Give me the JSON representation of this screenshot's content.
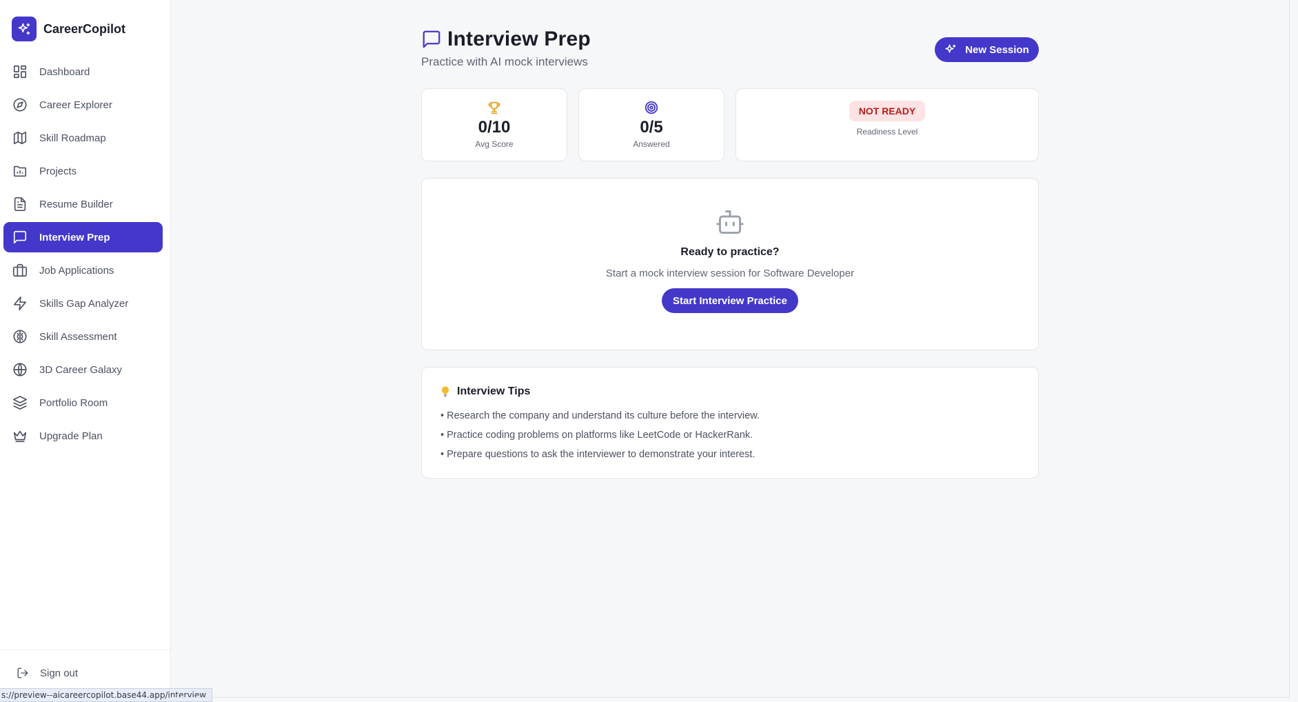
{
  "app": {
    "name": "CareerCopilot"
  },
  "sidebar": {
    "items": [
      {
        "label": "Dashboard",
        "icon": "grid-icon",
        "active": false
      },
      {
        "label": "Career Explorer",
        "icon": "compass-icon",
        "active": false
      },
      {
        "label": "Skill Roadmap",
        "icon": "map-icon",
        "active": false
      },
      {
        "label": "Projects",
        "icon": "folder-icon",
        "active": false
      },
      {
        "label": "Resume Builder",
        "icon": "file-text-icon",
        "active": false
      },
      {
        "label": "Interview Prep",
        "icon": "message-square-icon",
        "active": true
      },
      {
        "label": "Job Applications",
        "icon": "briefcase-icon",
        "active": false
      },
      {
        "label": "Skills Gap Analyzer",
        "icon": "zap-icon",
        "active": false
      },
      {
        "label": "Skill Assessment",
        "icon": "brain-icon",
        "active": false
      },
      {
        "label": "3D Career Galaxy",
        "icon": "globe-icon",
        "active": false
      },
      {
        "label": "Portfolio Room",
        "icon": "layers-icon",
        "active": false
      },
      {
        "label": "Upgrade Plan",
        "icon": "crown-icon",
        "active": false
      }
    ],
    "sign_out": "Sign out"
  },
  "status_url": "s://preview--aicareercopilot.base44.app/interview",
  "header": {
    "title": "Interview Prep",
    "subtitle": "Practice with AI mock interviews",
    "new_session_label": "New Session"
  },
  "stats": {
    "avg_score": {
      "value": "0/10",
      "caption": "Avg Score",
      "icon": "trophy-icon"
    },
    "answered": {
      "value": "0/5",
      "caption": "Answered",
      "icon": "target-icon"
    },
    "readiness": {
      "badge": "NOT READY",
      "caption": "Readiness Level"
    }
  },
  "practice": {
    "icon": "bot-icon",
    "heading": "Ready to practice?",
    "description": "Start a mock interview session for Software Developer",
    "button_label": "Start Interview Practice"
  },
  "tips": {
    "icon": "lightbulb-icon",
    "title": "Interview Tips",
    "items": [
      "• Research the company and understand its culture before the interview.",
      "• Practice coding problems on platforms like LeetCode or HackerRank.",
      "• Prepare questions to ask the interviewer to demonstrate your interest."
    ]
  },
  "colors": {
    "accent": "#4338ca",
    "badge_bg": "#fde3e3",
    "badge_text": "#b91c1c",
    "trophy": "#e8a11c"
  }
}
